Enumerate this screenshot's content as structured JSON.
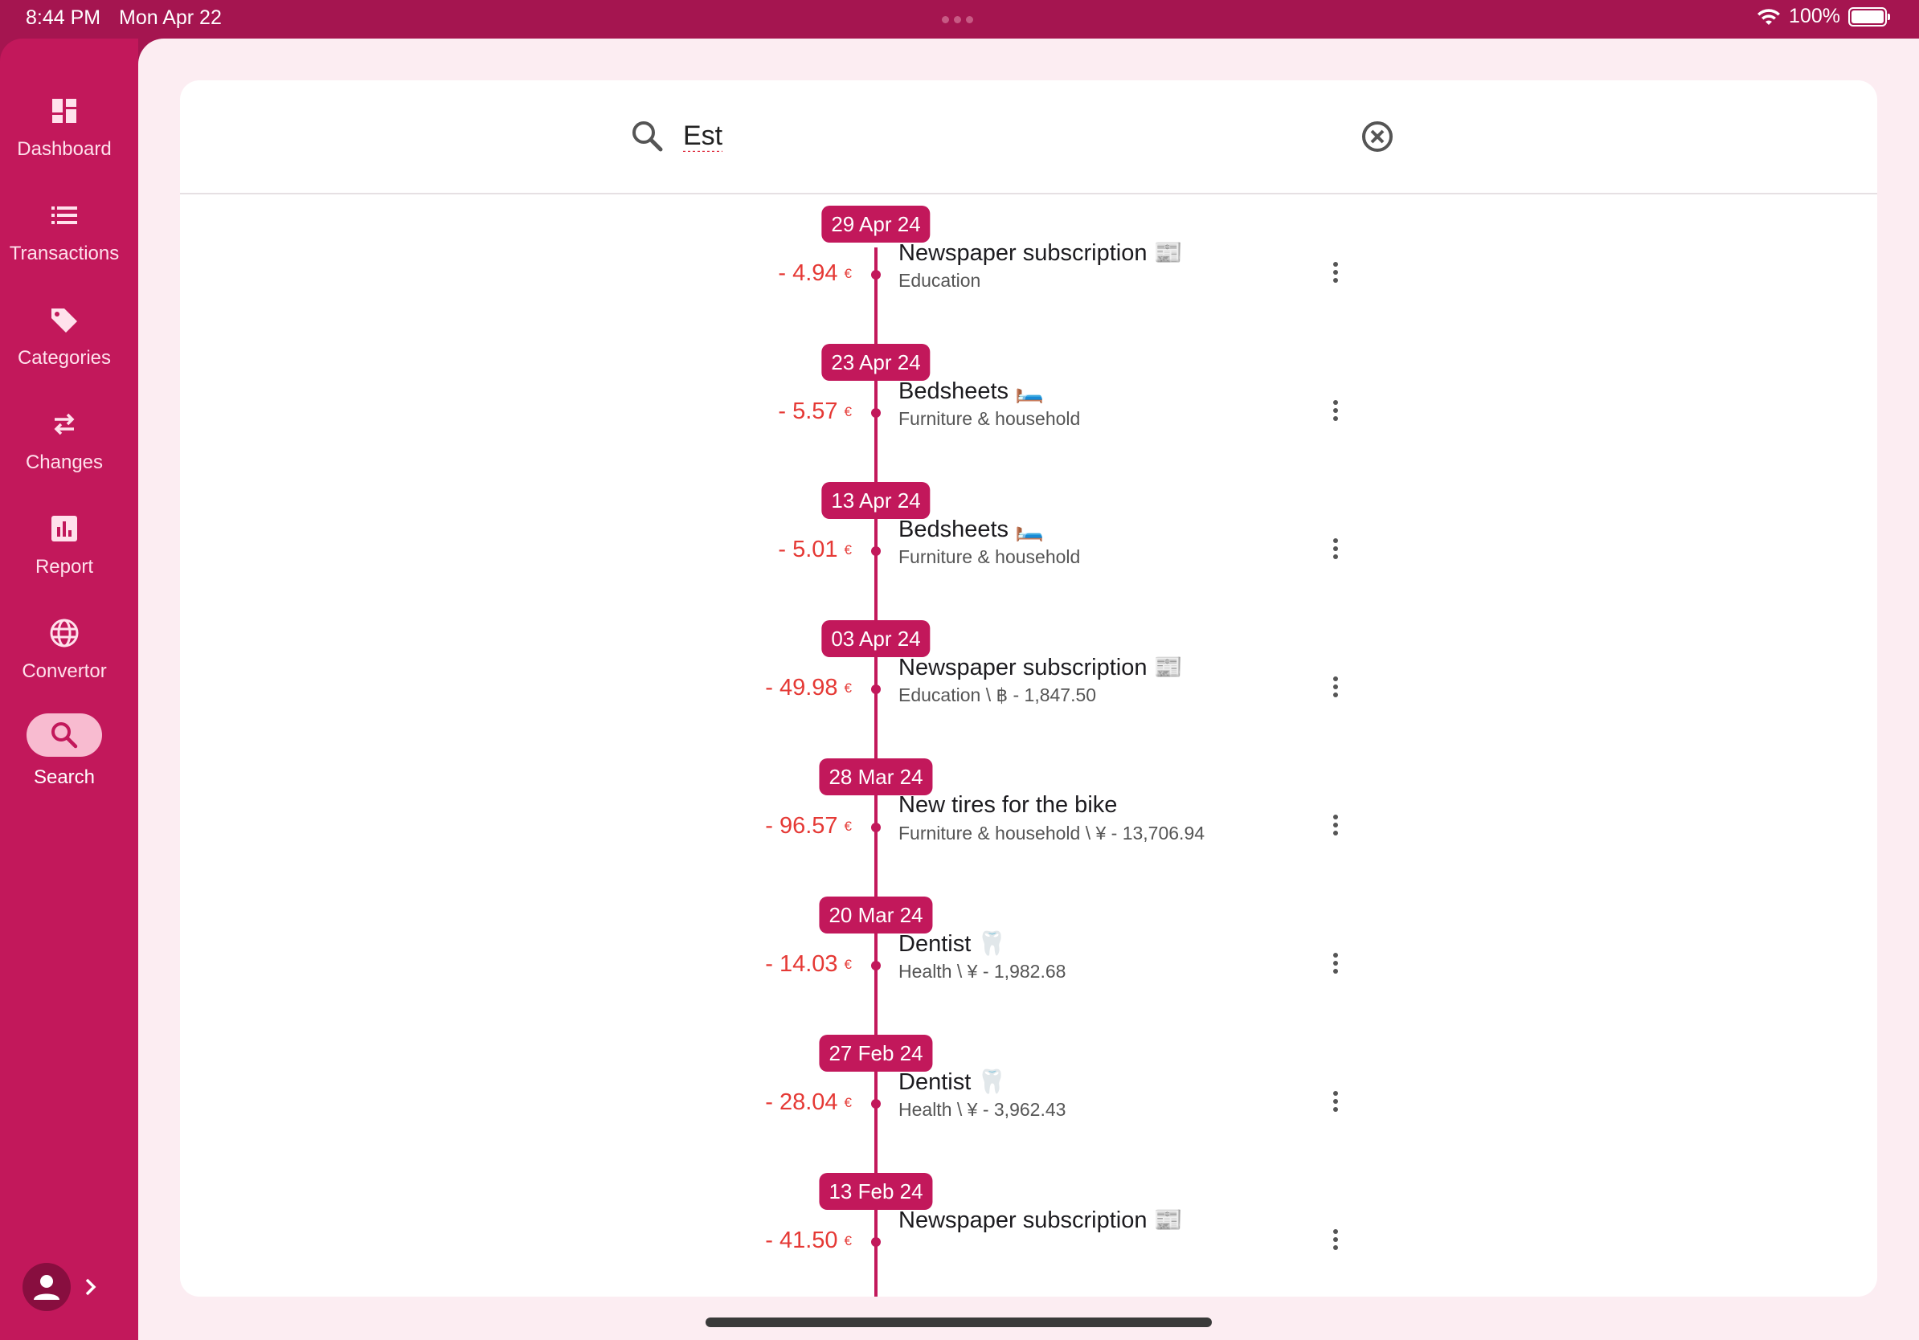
{
  "status": {
    "time": "8:44 PM",
    "date": "Mon Apr 22",
    "battery": "100%"
  },
  "nav": {
    "items": [
      {
        "label": "Dashboard",
        "icon": "dashboard-icon"
      },
      {
        "label": "Transactions",
        "icon": "list-icon"
      },
      {
        "label": "Categories",
        "icon": "tag-icon"
      },
      {
        "label": "Changes",
        "icon": "swap-arrows-icon"
      },
      {
        "label": "Report",
        "icon": "bar-chart-icon"
      },
      {
        "label": "Convertor",
        "icon": "globe-icon"
      },
      {
        "label": "Search",
        "icon": "search-icon",
        "active": true
      }
    ]
  },
  "search": {
    "query": "Est"
  },
  "timeline": [
    {
      "date": "29 Apr 24",
      "amount": "- 4.94",
      "currency": "€",
      "title": "Newspaper subscription 📰",
      "subtitle": "Education"
    },
    {
      "date": "23 Apr 24",
      "amount": "- 5.57",
      "currency": "€",
      "title": "Bedsheets 🛏️",
      "subtitle": "Furniture & household"
    },
    {
      "date": "13 Apr 24",
      "amount": "- 5.01",
      "currency": "€",
      "title": "Bedsheets 🛏️",
      "subtitle": "Furniture & household"
    },
    {
      "date": "03 Apr 24",
      "amount": "- 49.98",
      "currency": "€",
      "title": "Newspaper subscription 📰",
      "subtitle": "Education \\ ฿ - 1,847.50"
    },
    {
      "date": "28 Mar 24",
      "amount": "- 96.57",
      "currency": "€",
      "title": "New tires for the bike",
      "subtitle": "Furniture & household \\ ¥ - 13,706.94"
    },
    {
      "date": "20 Mar 24",
      "amount": "- 14.03",
      "currency": "€",
      "title": "Dentist 🦷",
      "subtitle": "Health \\ ¥ - 1,982.68"
    },
    {
      "date": "27 Feb 24",
      "amount": "- 28.04",
      "currency": "€",
      "title": "Dentist 🦷",
      "subtitle": "Health \\ ¥ - 3,962.43"
    },
    {
      "date": "13 Feb 24",
      "amount": "- 41.50",
      "currency": "€",
      "title": "Newspaper subscription 📰",
      "subtitle": ""
    }
  ]
}
